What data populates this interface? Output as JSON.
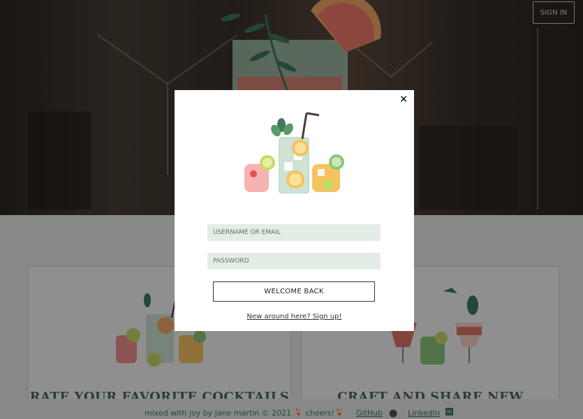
{
  "header": {
    "signin_label": "SIGN IN"
  },
  "cards": [
    {
      "title": "RATE YOUR FAVORITE COCKTAILS"
    },
    {
      "title": "CRAFT AND SHARE NEW DRINKS!"
    }
  ],
  "footer": {
    "credit": "mixed with joy by jane martin © 2021 🍹 cheers!🍹",
    "github_label": "GitHub",
    "linkedin_label": "LinkedIn"
  },
  "modal": {
    "close_label": "×",
    "username_placeholder": "USERNAME OR EMAIL",
    "password_placeholder": "PASSWORD",
    "submit_label": "WELCOME BACK",
    "signup_link": "New around here? Sign up!"
  },
  "colors": {
    "accent_green": "#3f7a5a",
    "field_bg": "#e3ede6",
    "modal_bg": "#ffffff"
  },
  "icons": {
    "github": "github-icon",
    "linkedin": "linkedin-icon",
    "close": "close-icon"
  }
}
